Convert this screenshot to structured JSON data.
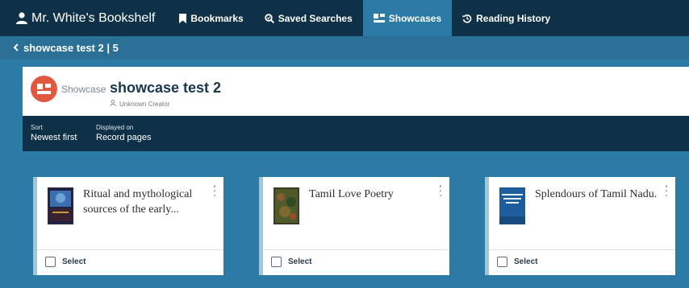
{
  "nav": {
    "brand": "Mr. White's Bookshelf",
    "items": [
      {
        "label": "Bookmarks",
        "icon": "bookmark-icon"
      },
      {
        "label": "Saved Searches",
        "icon": "saved-search-icon"
      },
      {
        "label": "Showcases",
        "icon": "showcases-icon",
        "active": true
      },
      {
        "label": "Reading History",
        "icon": "history-icon"
      }
    ]
  },
  "breadcrumb": {
    "text": "showcase test 2 | 5"
  },
  "showcase": {
    "type_label": "Showcase",
    "title": "showcase test 2",
    "creator": "Unknown Creator",
    "sort": {
      "label": "Sort",
      "value": "Newest first"
    },
    "displayed": {
      "label": "Displayed on",
      "value": "Record pages"
    }
  },
  "cards": [
    {
      "title": "Ritual and mythological sources of the early...",
      "select_label": "Select",
      "checked": false
    },
    {
      "title": "Tamil Love Poetry",
      "select_label": "Select",
      "checked": false
    },
    {
      "title": "Splendours of Tamil Nadu.",
      "select_label": "Select",
      "checked": false
    }
  ],
  "colors": {
    "nav_bg": "#0f3147",
    "page_bg": "#2c7ba7",
    "accent_badge": "#e2583e",
    "card_left_border": "#9cc7dc"
  }
}
